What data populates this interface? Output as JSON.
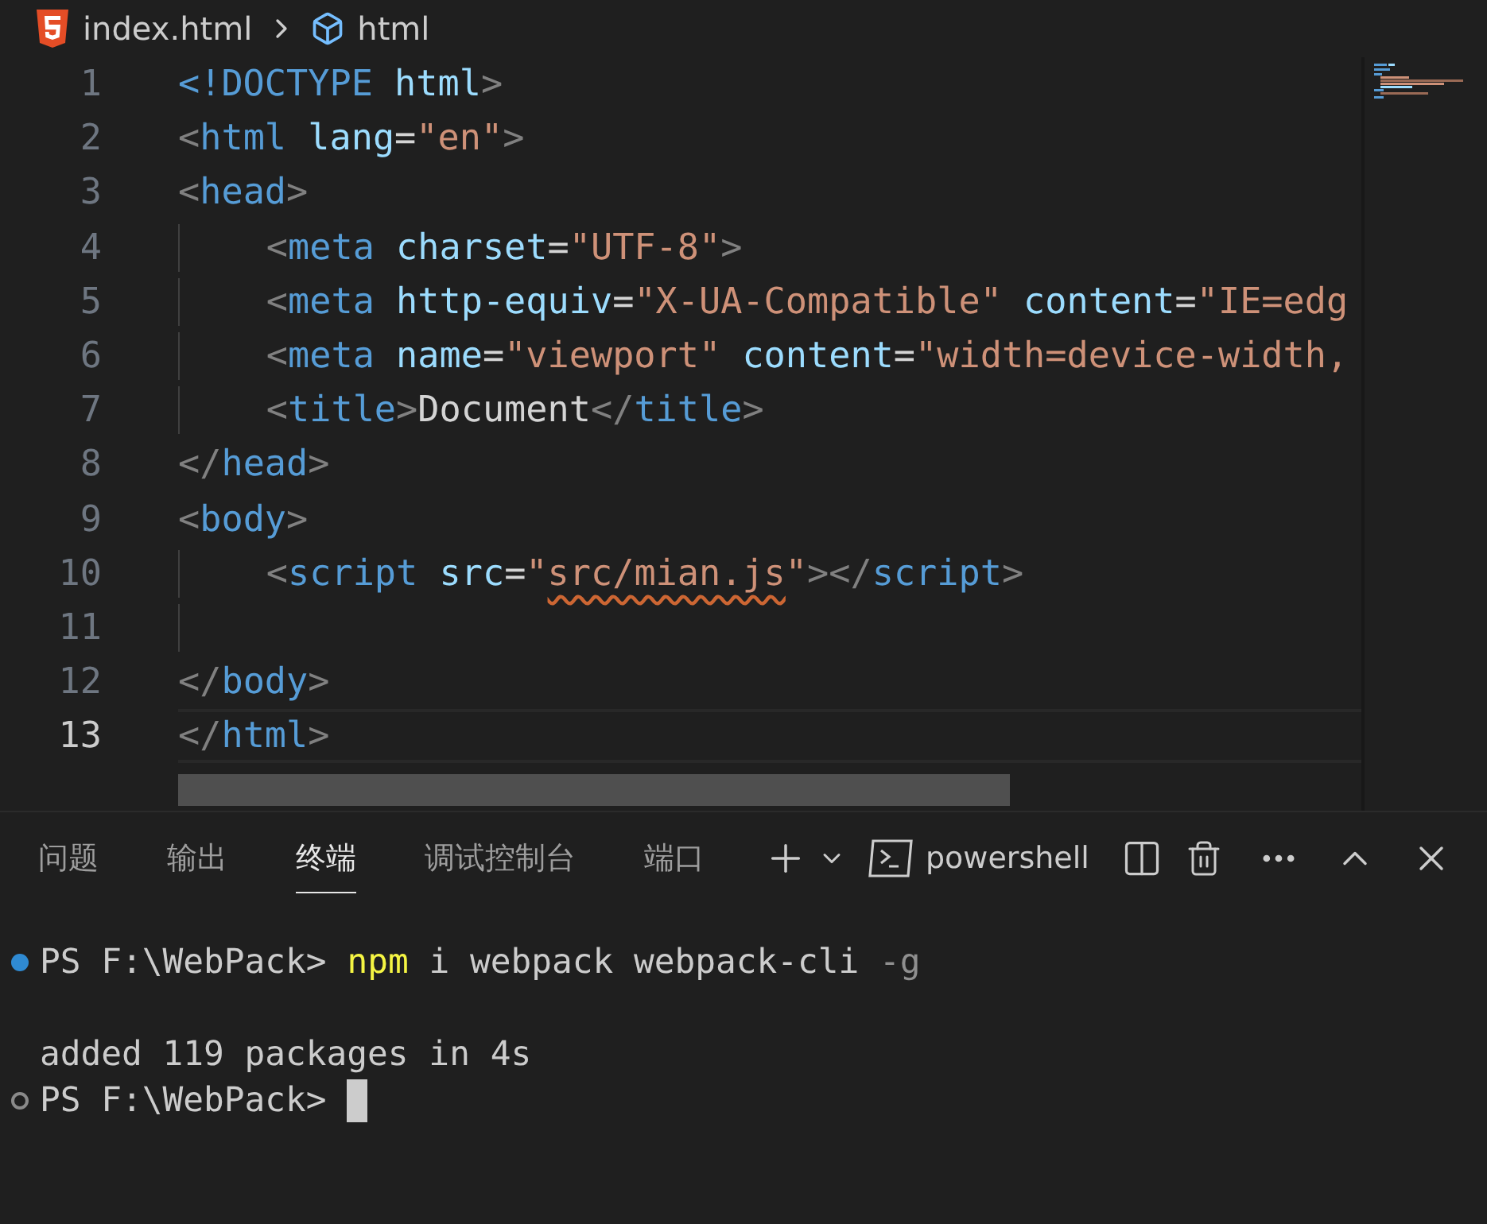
{
  "breadcrumb": {
    "file": "index.html",
    "symbol": "html"
  },
  "editor": {
    "lines": [
      {
        "number": "1",
        "current": false,
        "tokens": [
          {
            "kind": "tag",
            "text": "<!DOCTYPE"
          },
          {
            "kind": "attr",
            "text": " html"
          },
          {
            "kind": "punct",
            "text": ">"
          }
        ]
      },
      {
        "number": "2",
        "current": false,
        "tokens": [
          {
            "kind": "punct",
            "text": "<"
          },
          {
            "kind": "tag",
            "text": "html"
          },
          {
            "kind": "attr",
            "text": " lang"
          },
          {
            "kind": "op",
            "text": "="
          },
          {
            "kind": "string",
            "text": "\"en\""
          },
          {
            "kind": "punct",
            "text": ">"
          }
        ]
      },
      {
        "number": "3",
        "current": false,
        "tokens": [
          {
            "kind": "punct",
            "text": "<"
          },
          {
            "kind": "tag",
            "text": "head"
          },
          {
            "kind": "punct",
            "text": ">"
          }
        ]
      },
      {
        "number": "4",
        "current": false,
        "indented": true,
        "tokens": [
          {
            "kind": "punct",
            "text": "<"
          },
          {
            "kind": "tag",
            "text": "meta"
          },
          {
            "kind": "attr",
            "text": " charset"
          },
          {
            "kind": "op",
            "text": "="
          },
          {
            "kind": "string",
            "text": "\"UTF-8\""
          },
          {
            "kind": "punct",
            "text": ">"
          }
        ]
      },
      {
        "number": "5",
        "current": false,
        "indented": true,
        "tokens": [
          {
            "kind": "punct",
            "text": "<"
          },
          {
            "kind": "tag",
            "text": "meta"
          },
          {
            "kind": "attr",
            "text": " http-equiv"
          },
          {
            "kind": "op",
            "text": "="
          },
          {
            "kind": "string",
            "text": "\"X-UA-Compatible\""
          },
          {
            "kind": "attr",
            "text": " content"
          },
          {
            "kind": "op",
            "text": "="
          },
          {
            "kind": "string",
            "text": "\"IE=edg"
          }
        ]
      },
      {
        "number": "6",
        "current": false,
        "indented": true,
        "tokens": [
          {
            "kind": "punct",
            "text": "<"
          },
          {
            "kind": "tag",
            "text": "meta"
          },
          {
            "kind": "attr",
            "text": " name"
          },
          {
            "kind": "op",
            "text": "="
          },
          {
            "kind": "string",
            "text": "\"viewport\""
          },
          {
            "kind": "attr",
            "text": " content"
          },
          {
            "kind": "op",
            "text": "="
          },
          {
            "kind": "string",
            "text": "\"width=device-width,"
          }
        ]
      },
      {
        "number": "7",
        "current": false,
        "indented": true,
        "tokens": [
          {
            "kind": "punct",
            "text": "<"
          },
          {
            "kind": "tag",
            "text": "title"
          },
          {
            "kind": "punct",
            "text": ">"
          },
          {
            "kind": "text",
            "text": "Document"
          },
          {
            "kind": "punct",
            "text": "</"
          },
          {
            "kind": "tag",
            "text": "title"
          },
          {
            "kind": "punct",
            "text": ">"
          }
        ]
      },
      {
        "number": "8",
        "current": false,
        "tokens": [
          {
            "kind": "punct",
            "text": "</"
          },
          {
            "kind": "tag",
            "text": "head"
          },
          {
            "kind": "punct",
            "text": ">"
          }
        ]
      },
      {
        "number": "9",
        "current": false,
        "tokens": [
          {
            "kind": "punct",
            "text": "<"
          },
          {
            "kind": "tag",
            "text": "body"
          },
          {
            "kind": "punct",
            "text": ">"
          }
        ]
      },
      {
        "number": "10",
        "current": false,
        "indented": true,
        "tokens": [
          {
            "kind": "punct",
            "text": "<"
          },
          {
            "kind": "tag",
            "text": "script"
          },
          {
            "kind": "attr",
            "text": " src"
          },
          {
            "kind": "op",
            "text": "="
          },
          {
            "kind": "string",
            "text": "\""
          },
          {
            "kind": "warning",
            "text": "src/mian.js"
          },
          {
            "kind": "string",
            "text": "\""
          },
          {
            "kind": "punct",
            "text": "></"
          },
          {
            "kind": "tag",
            "text": "script"
          },
          {
            "kind": "punct",
            "text": ">"
          }
        ]
      },
      {
        "number": "11",
        "current": false,
        "indented": true
      },
      {
        "number": "12",
        "current": false,
        "tokens": [
          {
            "kind": "punct",
            "text": "</"
          },
          {
            "kind": "tag",
            "text": "body"
          },
          {
            "kind": "punct",
            "text": ">"
          }
        ]
      },
      {
        "number": "13",
        "current": true,
        "tokens": [
          {
            "kind": "punct",
            "text": "</"
          },
          {
            "kind": "tag",
            "text": "html"
          },
          {
            "kind": "punct",
            "text": ">"
          }
        ]
      }
    ]
  },
  "panel": {
    "tabs": [
      {
        "label": "问题",
        "selected": false
      },
      {
        "label": "输出",
        "selected": false
      },
      {
        "label": "终端",
        "selected": true
      },
      {
        "label": "调试控制台",
        "selected": false
      },
      {
        "label": "端口",
        "selected": false
      }
    ],
    "shell": "powershell"
  },
  "terminal": {
    "lines": [
      {
        "kind": "success",
        "tokens": [
          {
            "kind": "prompt",
            "text": "PS F:\\WebPack> "
          },
          {
            "kind": "command",
            "text": "npm"
          },
          {
            "kind": "plain",
            "text": " i webpack webpack-cli "
          },
          {
            "kind": "flag",
            "text": "-g"
          }
        ]
      },
      {
        "kind": "blank"
      },
      {
        "kind": "output",
        "tokens": [
          {
            "kind": "plain",
            "text": "added 119 packages in 4s"
          }
        ]
      },
      {
        "kind": "idle",
        "cursor": true,
        "tokens": [
          {
            "kind": "prompt",
            "text": "PS F:\\WebPack> "
          }
        ]
      }
    ]
  }
}
